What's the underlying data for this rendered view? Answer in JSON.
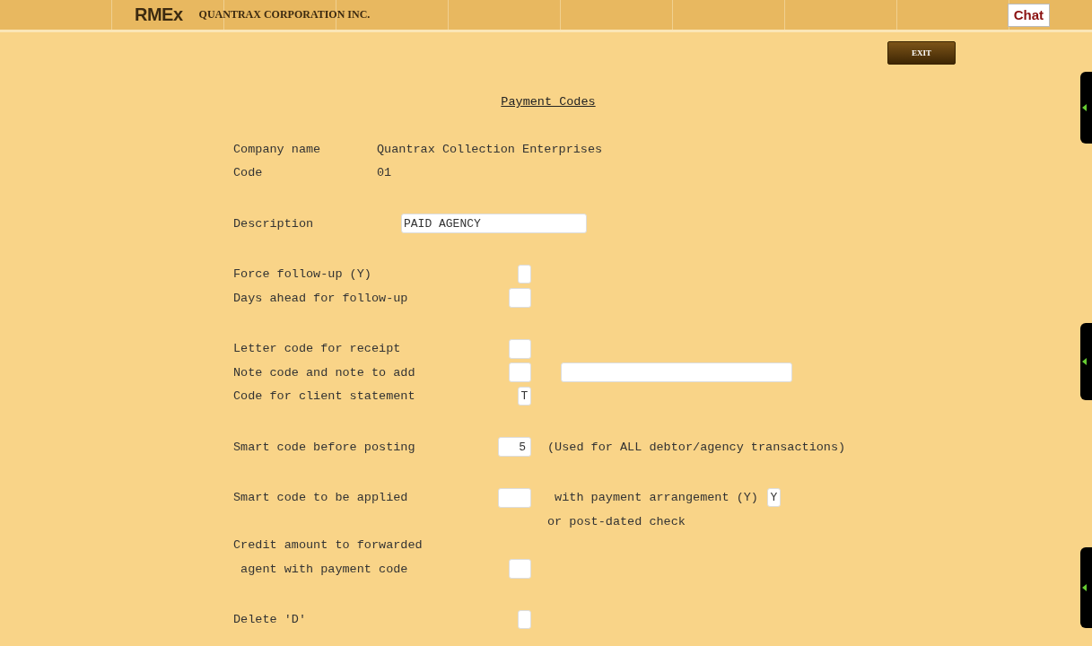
{
  "header": {
    "logo": "RMEx",
    "company": "QUANTRAX CORPORATION INC.",
    "chat_button": "Chat"
  },
  "exit_button": "EXIT",
  "title": "Payment Codes",
  "groups": [
    {
      "rows": [
        {
          "kind": "info",
          "label": "Company name",
          "value": "Quantrax Collection Enterprises"
        },
        {
          "kind": "info",
          "label": "Code",
          "value": "01"
        }
      ]
    },
    {
      "rows": [
        {
          "kind": "wide",
          "label": "Description",
          "value": "PAID AGENCY"
        }
      ]
    },
    {
      "rows": [
        {
          "kind": "tick",
          "label": "Force follow-up (Y)"
        },
        {
          "kind": "box",
          "label": "Days ahead for follow-up"
        }
      ]
    },
    {
      "rows": [
        {
          "kind": "box",
          "label": "Letter code for receipt"
        },
        {
          "kind": "boxnote",
          "label": "Note code and note to add"
        },
        {
          "kind": "tick",
          "label": "Code for client statement",
          "value": "T"
        }
      ]
    },
    {
      "rows": [
        {
          "kind": "code",
          "label": "Smart code before posting",
          "value": "5",
          "note": "(Used for ALL debtor/agency transactions)"
        }
      ]
    },
    {
      "rows": [
        {
          "kind": "code",
          "label": "Smart code to be applied",
          "extra_label": " with payment arrangement (Y)",
          "extra_value": "Y"
        },
        {
          "kind": "text",
          "note": "or post-dated check"
        },
        {
          "kind": "text",
          "label": "Credit amount to forwarded"
        },
        {
          "kind": "box",
          "label": " agent with payment code"
        }
      ]
    },
    {
      "rows": [
        {
          "kind": "tick",
          "label": "Delete 'D'"
        }
      ]
    }
  ]
}
